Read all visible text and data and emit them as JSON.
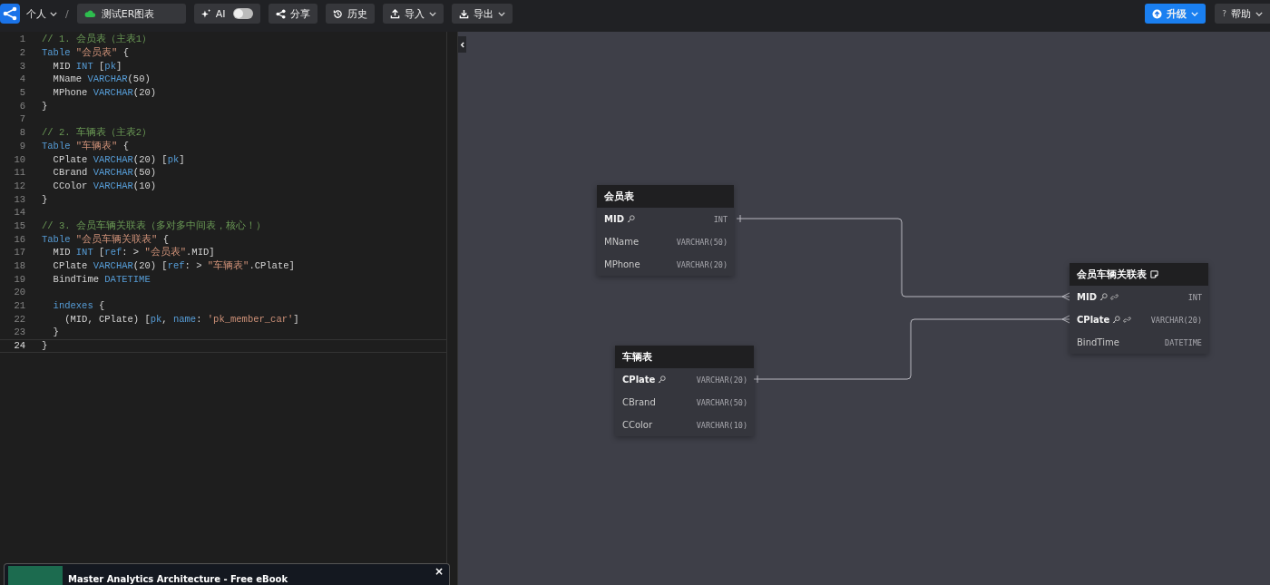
{
  "topbar": {
    "workspace": "个人",
    "separator": "/",
    "document_name": "测试ER图表",
    "ai": {
      "label": "AI",
      "on": false
    },
    "buttons": [
      {
        "label": "分享",
        "kind": "share",
        "dropdown": false
      },
      {
        "label": "历史",
        "kind": "history",
        "dropdown": false
      },
      {
        "label": "导入",
        "kind": "import",
        "dropdown": true
      },
      {
        "label": "导出",
        "kind": "export",
        "dropdown": true
      }
    ],
    "upgrade": "升级",
    "help": {
      "icon": "?",
      "label": "帮助"
    }
  },
  "editor": {
    "lines": [
      {
        "number": "1",
        "current": false,
        "tokens": [
          {
            "kind": "comment",
            "text": "// 1. 会员表（主表1）"
          }
        ]
      },
      {
        "number": "2",
        "current": false,
        "tokens": [
          {
            "kind": "keyword",
            "text": "Table"
          },
          {
            "kind": "string",
            "text": " \"会员表\""
          },
          {
            "kind": "plain",
            "text": " {"
          }
        ]
      },
      {
        "number": "3",
        "current": false,
        "tokens": [
          {
            "kind": "plain",
            "text": "  MID "
          },
          {
            "kind": "keyword",
            "text": "INT"
          },
          {
            "kind": "plain",
            "text": " ["
          },
          {
            "kind": "keyword",
            "text": "pk"
          },
          {
            "kind": "plain",
            "text": "]"
          }
        ]
      },
      {
        "number": "4",
        "current": false,
        "tokens": [
          {
            "kind": "plain",
            "text": "  MName "
          },
          {
            "kind": "keyword",
            "text": "VARCHAR"
          },
          {
            "kind": "plain",
            "text": "(50)"
          }
        ]
      },
      {
        "number": "5",
        "current": false,
        "tokens": [
          {
            "kind": "plain",
            "text": "  MPhone "
          },
          {
            "kind": "keyword",
            "text": "VARCHAR"
          },
          {
            "kind": "plain",
            "text": "(20)"
          }
        ]
      },
      {
        "number": "6",
        "current": false,
        "tokens": [
          {
            "kind": "plain",
            "text": "}"
          }
        ]
      },
      {
        "number": "7",
        "current": false
      },
      {
        "number": "8",
        "current": false,
        "tokens": [
          {
            "kind": "comment",
            "text": "// 2. 车辆表（主表2）"
          }
        ]
      },
      {
        "number": "9",
        "current": false,
        "tokens": [
          {
            "kind": "keyword",
            "text": "Table"
          },
          {
            "kind": "string",
            "text": " \"车辆表\""
          },
          {
            "kind": "plain",
            "text": " {"
          }
        ]
      },
      {
        "number": "10",
        "current": false,
        "tokens": [
          {
            "kind": "plain",
            "text": "  CPlate "
          },
          {
            "kind": "keyword",
            "text": "VARCHAR"
          },
          {
            "kind": "plain",
            "text": "(20) ["
          },
          {
            "kind": "keyword",
            "text": "pk"
          },
          {
            "kind": "plain",
            "text": "]"
          }
        ]
      },
      {
        "number": "11",
        "current": false,
        "tokens": [
          {
            "kind": "plain",
            "text": "  CBrand "
          },
          {
            "kind": "keyword",
            "text": "VARCHAR"
          },
          {
            "kind": "plain",
            "text": "(50)"
          }
        ]
      },
      {
        "number": "12",
        "current": false,
        "tokens": [
          {
            "kind": "plain",
            "text": "  CColor "
          },
          {
            "kind": "keyword",
            "text": "VARCHAR"
          },
          {
            "kind": "plain",
            "text": "(10)"
          }
        ]
      },
      {
        "number": "13",
        "current": false,
        "tokens": [
          {
            "kind": "plain",
            "text": "}"
          }
        ]
      },
      {
        "number": "14",
        "current": false
      },
      {
        "number": "15",
        "current": false,
        "tokens": [
          {
            "kind": "comment",
            "text": "// 3. 会员车辆关联表（多对多中间表，核心！）"
          }
        ]
      },
      {
        "number": "16",
        "current": false,
        "tokens": [
          {
            "kind": "keyword",
            "text": "Table"
          },
          {
            "kind": "string",
            "text": " \"会员车辆关联表\""
          },
          {
            "kind": "plain",
            "text": " {"
          }
        ]
      },
      {
        "number": "17",
        "current": false,
        "tokens": [
          {
            "kind": "plain",
            "text": "  MID "
          },
          {
            "kind": "keyword",
            "text": "INT"
          },
          {
            "kind": "plain",
            "text": " ["
          },
          {
            "kind": "keyword",
            "text": "ref"
          },
          {
            "kind": "plain",
            "text": ": > "
          },
          {
            "kind": "string",
            "text": "\"会员表\""
          },
          {
            "kind": "plain",
            "text": ".MID]"
          }
        ]
      },
      {
        "number": "18",
        "current": false,
        "tokens": [
          {
            "kind": "plain",
            "text": "  CPlate "
          },
          {
            "kind": "keyword",
            "text": "VARCHAR"
          },
          {
            "kind": "plain",
            "text": "(20) ["
          },
          {
            "kind": "keyword",
            "text": "ref"
          },
          {
            "kind": "plain",
            "text": ": > "
          },
          {
            "kind": "string",
            "text": "\"车辆表\""
          },
          {
            "kind": "plain",
            "text": ".CPlate]"
          }
        ]
      },
      {
        "number": "19",
        "current": false,
        "tokens": [
          {
            "kind": "plain",
            "text": "  BindTime "
          },
          {
            "kind": "keyword",
            "text": "DATETIME"
          }
        ]
      },
      {
        "number": "20",
        "current": false
      },
      {
        "number": "21",
        "current": false,
        "tokens": [
          {
            "kind": "keyword",
            "text": "  indexes"
          },
          {
            "kind": "plain",
            "text": " {"
          }
        ]
      },
      {
        "number": "22",
        "current": false,
        "tokens": [
          {
            "kind": "plain",
            "text": "    (MID, CPlate) ["
          },
          {
            "kind": "keyword",
            "text": "pk"
          },
          {
            "kind": "plain",
            "text": ", "
          },
          {
            "kind": "keyword",
            "text": "name"
          },
          {
            "kind": "plain",
            "text": ": "
          },
          {
            "kind": "string",
            "text": "'pk_member_car'"
          },
          {
            "kind": "plain",
            "text": "]"
          }
        ]
      },
      {
        "number": "23",
        "current": false,
        "tokens": [
          {
            "kind": "plain",
            "text": "  }"
          }
        ]
      },
      {
        "number": "24",
        "current": true,
        "tokens": [
          {
            "kind": "plain",
            "text": "}"
          }
        ]
      }
    ]
  },
  "diagram": {
    "tables": [
      {
        "name": "会员表",
        "note": false,
        "fields": [
          {
            "name": "MID",
            "type": "INT",
            "pk": true,
            "ref": false
          },
          {
            "name": "MName",
            "type": "VARCHAR(50)",
            "pk": false,
            "ref": false
          },
          {
            "name": "MPhone",
            "type": "VARCHAR(20)",
            "pk": false,
            "ref": false
          }
        ]
      },
      {
        "name": "车辆表",
        "note": false,
        "fields": [
          {
            "name": "CPlate",
            "type": "VARCHAR(20)",
            "pk": true,
            "ref": false
          },
          {
            "name": "CBrand",
            "type": "VARCHAR(50)",
            "pk": false,
            "ref": false
          },
          {
            "name": "CColor",
            "type": "VARCHAR(10)",
            "pk": false,
            "ref": false
          }
        ]
      },
      {
        "name": "会员车辆关联表",
        "note": true,
        "fields": [
          {
            "name": "MID",
            "type": "INT",
            "pk": true,
            "ref": true
          },
          {
            "name": "CPlate",
            "type": "VARCHAR(20)",
            "pk": true,
            "ref": true
          },
          {
            "name": "BindTime",
            "type": "DATETIME",
            "pk": false,
            "ref": false
          }
        ]
      }
    ]
  },
  "ad": {
    "title": "Master Analytics Architecture - Free eBook",
    "close": "×"
  }
}
